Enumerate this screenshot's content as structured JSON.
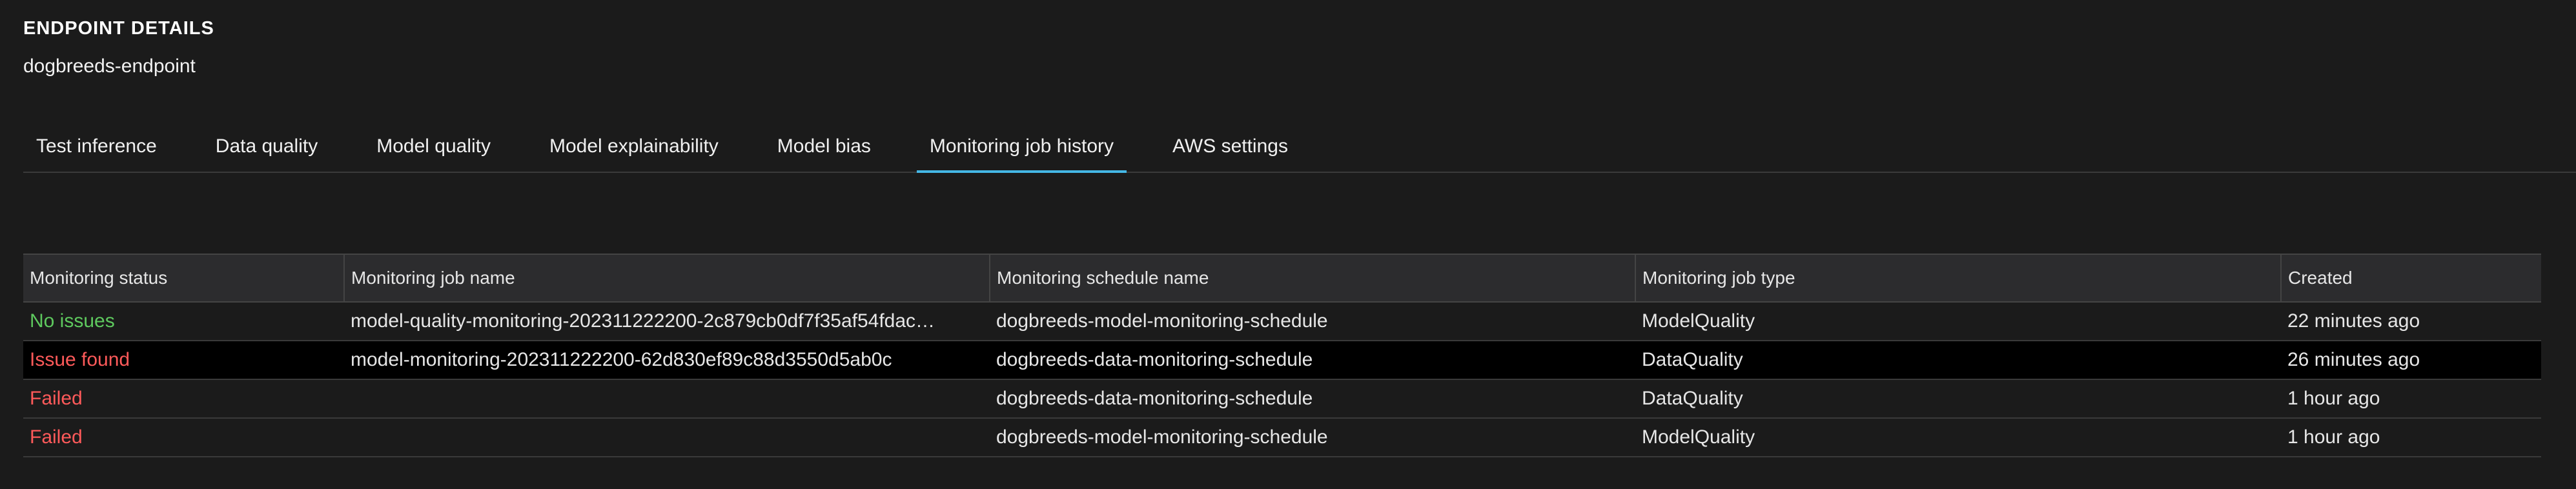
{
  "header": {
    "section_title": "ENDPOINT DETAILS",
    "endpoint_name": "dogbreeds-endpoint"
  },
  "tabs": [
    {
      "label": "Test inference",
      "active": false
    },
    {
      "label": "Data quality",
      "active": false
    },
    {
      "label": "Model quality",
      "active": false
    },
    {
      "label": "Model explainability",
      "active": false
    },
    {
      "label": "Model bias",
      "active": false
    },
    {
      "label": "Monitoring job history",
      "active": true
    },
    {
      "label": "AWS settings",
      "active": false
    }
  ],
  "table": {
    "columns": [
      "Monitoring status",
      "Monitoring job name",
      "Monitoring schedule name",
      "Monitoring job type",
      "Created"
    ],
    "rows": [
      {
        "status": "No issues",
        "job_name": "model-quality-monitoring-202311222200-2c879cb0df7f35af54fdac…",
        "schedule": "dogbreeds-model-monitoring-schedule",
        "job_type": "ModelQuality",
        "created": "22 minutes ago"
      },
      {
        "status": "Issue found",
        "job_name": "model-monitoring-202311222200-62d830ef89c88d3550d5ab0c",
        "schedule": "dogbreeds-data-monitoring-schedule",
        "job_type": "DataQuality",
        "created": "26 minutes ago"
      },
      {
        "status": "Failed",
        "job_name": "",
        "schedule": "dogbreeds-data-monitoring-schedule",
        "job_type": "DataQuality",
        "created": "1 hour ago"
      },
      {
        "status": "Failed",
        "job_name": "",
        "schedule": "dogbreeds-model-monitoring-schedule",
        "job_type": "ModelQuality",
        "created": "1 hour ago"
      }
    ]
  },
  "colors": {
    "status_ok": "#5ec95e",
    "status_bad": "#ff5a5a",
    "tab_active_underline": "#45b8e6",
    "background": "#1b1b1b"
  }
}
